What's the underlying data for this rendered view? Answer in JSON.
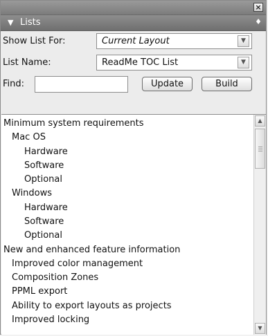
{
  "header": {
    "title": "Lists"
  },
  "controls": {
    "show_list_for": {
      "label": "Show List For:",
      "value": "Current Layout"
    },
    "list_name": {
      "label": "List Name:",
      "value": "ReadMe TOC List"
    },
    "find": {
      "label": "Find:",
      "value": ""
    },
    "update_label": "Update",
    "build_label": "Build"
  },
  "list": {
    "items": [
      {
        "text": "Minimum system requirements",
        "level": 0
      },
      {
        "text": "Mac OS",
        "level": 1
      },
      {
        "text": "Hardware",
        "level": 2
      },
      {
        "text": "Software",
        "level": 2
      },
      {
        "text": "Optional",
        "level": 2
      },
      {
        "text": "Windows",
        "level": 1
      },
      {
        "text": "Hardware",
        "level": 2
      },
      {
        "text": "Software",
        "level": 2
      },
      {
        "text": "Optional",
        "level": 2
      },
      {
        "text": "New and enhanced feature information",
        "level": 0
      },
      {
        "text": "Improved color management",
        "level": 1
      },
      {
        "text": "Composition Zones",
        "level": 1
      },
      {
        "text": "PPML export",
        "level": 1
      },
      {
        "text": "Ability to export layouts as projects",
        "level": 1
      },
      {
        "text": "Improved locking",
        "level": 1
      }
    ]
  },
  "icons": {
    "close": "close-icon",
    "collapse": "triangle-down-icon",
    "menu": "diamond-icon",
    "dropdown": "chevron-down-icon",
    "scroll_up": "chevron-up-icon",
    "scroll_down": "chevron-down-icon"
  }
}
